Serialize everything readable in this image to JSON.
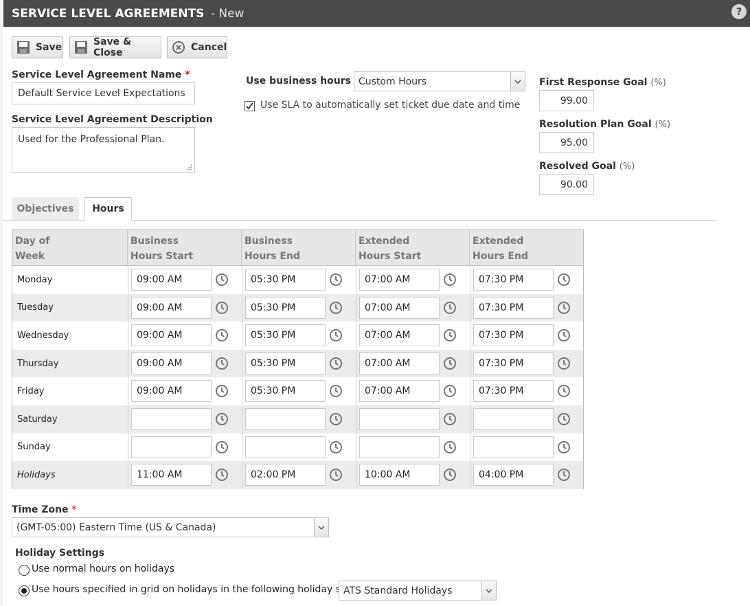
{
  "window": {
    "title": "SERVICE LEVEL AGREEMENTS",
    "subtitle": "New"
  },
  "toolbar": {
    "save_label": "Save",
    "save_close_label": "Save & Close",
    "cancel_label": "Cancel"
  },
  "form": {
    "name_label": "Service Level Agreement Name",
    "name_required": "*",
    "name_value": "Default Service Level Expectations",
    "description_label": "Service Level Agreement Description",
    "description_value": "Used for the Professional Plan.",
    "business_hours_label": "Use business hours of",
    "business_hours_value": "Custom Hours",
    "auto_due_label": "Use SLA to automatically set ticket due date and time",
    "auto_due_checked": true,
    "goals": [
      {
        "label": "First Response Goal",
        "unit": "(%)",
        "value": "99.00"
      },
      {
        "label": "Resolution Plan Goal",
        "unit": "(%)",
        "value": "95.00"
      },
      {
        "label": "Resolved Goal",
        "unit": "(%)",
        "value": "90.00"
      }
    ]
  },
  "tabs": [
    {
      "label": "Objectives",
      "active": false
    },
    {
      "label": "Hours",
      "active": true
    }
  ],
  "hours_grid": {
    "headers": [
      [
        "Day of",
        "Week"
      ],
      [
        "Business",
        "Hours Start"
      ],
      [
        "Business",
        "Hours End"
      ],
      [
        "Extended",
        "Hours Start"
      ],
      [
        "Extended",
        "Hours End"
      ]
    ],
    "rows": [
      {
        "day": "Monday",
        "values": [
          "09:00 AM",
          "05:30 PM",
          "07:00 AM",
          "07:30 PM"
        ]
      },
      {
        "day": "Tuesday",
        "values": [
          "09:00 AM",
          "05:30 PM",
          "07:00 AM",
          "07:30 PM"
        ]
      },
      {
        "day": "Wednesday",
        "values": [
          "09:00 AM",
          "05:30 PM",
          "07:00 AM",
          "07:30 PM"
        ]
      },
      {
        "day": "Thursday",
        "values": [
          "09:00 AM",
          "05:30 PM",
          "07:00 AM",
          "07:30 PM"
        ]
      },
      {
        "day": "Friday",
        "values": [
          "09:00 AM",
          "05:30 PM",
          "07:00 AM",
          "07:30 PM"
        ]
      },
      {
        "day": "Saturday",
        "values": [
          "",
          "",
          "",
          ""
        ]
      },
      {
        "day": "Sunday",
        "values": [
          "",
          "",
          "",
          ""
        ]
      },
      {
        "day": "Holidays",
        "values": [
          "11:00 AM",
          "02:00 PM",
          "10:00 AM",
          "04:00 PM"
        ]
      }
    ]
  },
  "timezone": {
    "label": "Time Zone",
    "required": "*",
    "value": "(GMT-05:00) Eastern Time (US & Canada)"
  },
  "holiday": {
    "label": "Holiday Settings",
    "option_normal": "Use normal hours on holidays",
    "option_grid": "Use hours specified in grid on holidays in the following holiday set:",
    "selected": "grid",
    "holiday_set_value": "ATS Standard Holidays"
  },
  "icons": {
    "help": "help-icon",
    "save": "floppy-disk-icon",
    "cancel": "cancel-circle-icon",
    "clock": "clock-icon",
    "dropdown": "chevron-down-icon",
    "checkmark": "checkmark-icon"
  },
  "colors": {
    "titlebar": "#4a4a4a",
    "required": "#cc0000",
    "row_alt": "#ececec",
    "header_bg": "#e6e6e6"
  }
}
